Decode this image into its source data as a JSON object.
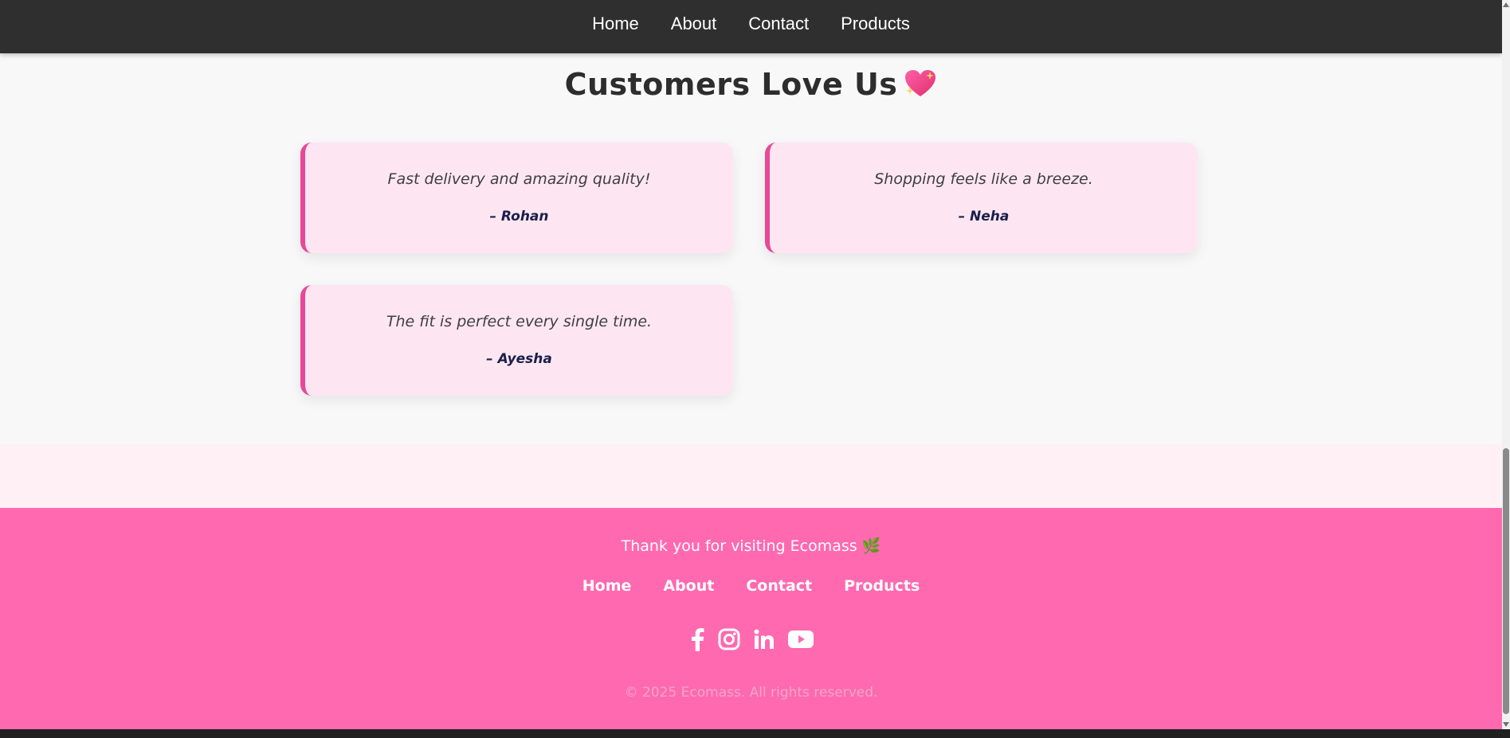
{
  "nav": {
    "items": [
      {
        "label": "Home"
      },
      {
        "label": "About"
      },
      {
        "label": "Contact"
      },
      {
        "label": "Products"
      }
    ]
  },
  "testimonials": {
    "title": "Customers Love Us",
    "title_emoji": "sparkling-heart-icon",
    "cards": [
      {
        "quote": "Fast delivery and amazing quality!",
        "author": "– Rohan"
      },
      {
        "quote": "Shopping feels like a breeze.",
        "author": "– Neha"
      },
      {
        "quote": "The fit is perfect every single time.",
        "author": "– Ayesha"
      }
    ]
  },
  "footer": {
    "thanks": "Thank you for visiting Ecomass 🌿",
    "links": [
      {
        "label": "Home"
      },
      {
        "label": "About"
      },
      {
        "label": "Contact"
      },
      {
        "label": "Products"
      }
    ],
    "socials": [
      "facebook-icon",
      "instagram-icon",
      "linkedin-icon",
      "youtube-icon"
    ],
    "copyright": "© 2025 Ecomass. All rights reserved."
  },
  "colors": {
    "nav_bg": "#2f2f2f",
    "card_bg": "#fde6f2",
    "card_accent": "#e84897",
    "footer_bg": "#ff69b0",
    "author_color": "#1b1f4b"
  }
}
